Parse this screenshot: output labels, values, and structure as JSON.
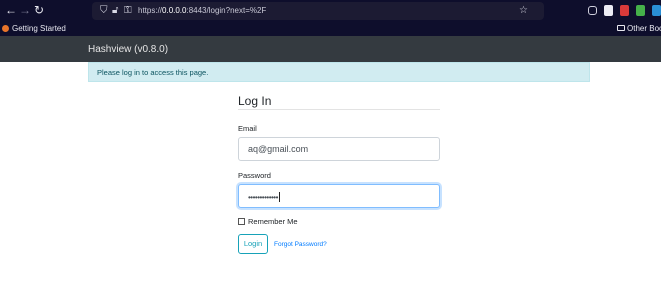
{
  "browser": {
    "url_prefix": "https://",
    "url_host": "0.0.0.0",
    "url_rest": ":8443/login?next=%2F",
    "bookmarks_left": "Getting Started",
    "bookmarks_right": "Other Book"
  },
  "navbar": {
    "brand": "Hashview (v0.8.0)"
  },
  "alert": {
    "message": "Please log in to access this page."
  },
  "login": {
    "title": "Log In",
    "email_label": "Email",
    "email_value": "aq@gmail.com",
    "password_label": "Password",
    "password_value": "•••••••••••••",
    "remember_label": "Remember Me",
    "remember_checked": false,
    "submit_label": "Login",
    "forgot_label": "Forgot Password?"
  },
  "colors": {
    "browser_bg": "#0e0e2c",
    "navbar_bg": "#343a40",
    "alert_bg": "#d1ecf1",
    "alert_text": "#0c5460",
    "button_accent": "#17a2b8",
    "link": "#007bff"
  },
  "icons": [
    "back-icon",
    "forward-icon",
    "reload-icon",
    "shield-icon",
    "lock-icon",
    "key-icon",
    "bookmark-star-icon",
    "pocket-icon",
    "extension-icon",
    "menu-icon"
  ]
}
